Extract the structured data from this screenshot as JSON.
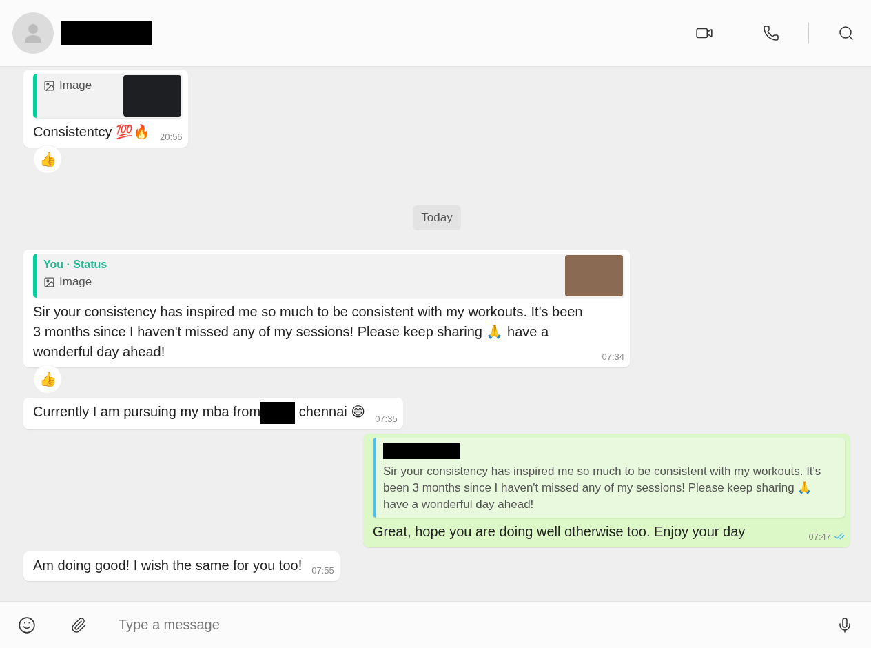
{
  "header": {
    "contact_name_redacted": true
  },
  "messages": [
    {
      "kind": "incoming",
      "quote": {
        "kind": "status",
        "label": "Image"
      },
      "text": "Consistentcy 💯🔥",
      "time": "20:56",
      "reaction": "👍"
    },
    {
      "kind": "date",
      "text": "Today"
    },
    {
      "kind": "incoming",
      "quote": {
        "kind": "status",
        "author": "You · Status",
        "label": "Image"
      },
      "text": "Sir your consistency has inspired me so much to be consistent with my workouts. It's been 3 months since I haven't missed any of my sessions! Please keep sharing 🙏 have a wonderful day ahead!",
      "time": "07:34",
      "reaction": "👍"
    },
    {
      "kind": "incoming",
      "parts": [
        "Currently I am pursuing my mba from",
        "chennai 😄"
      ],
      "time": "07:35"
    },
    {
      "kind": "outgoing",
      "quote": {
        "kind": "reply",
        "text": "Sir your consistency has inspired me so much to be consistent with my workouts. It's been 3 months since I haven't missed any of my sessions! Please keep sharing 🙏 have a wonderful day ahead!"
      },
      "text": "Great, hope you are doing well otherwise too. Enjoy your day",
      "time": "07:47",
      "read": true
    },
    {
      "kind": "incoming",
      "text": "Am doing good! I wish the same for you too!",
      "time": "07:55"
    }
  ],
  "composer": {
    "placeholder": "Type a message"
  }
}
